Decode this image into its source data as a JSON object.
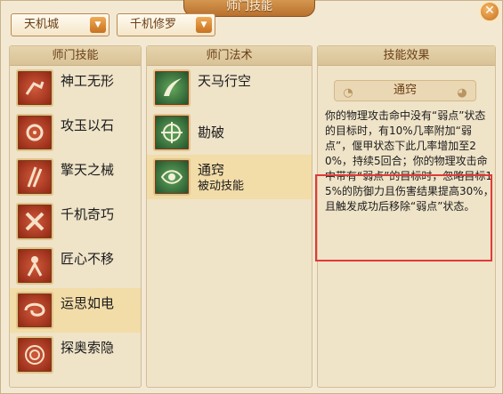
{
  "window": {
    "title": "师门技能",
    "close_symbol": "✕"
  },
  "filters": {
    "faction": {
      "selected": "天机城",
      "arrow_symbol": "▼"
    },
    "school": {
      "selected": "千机修罗",
      "arrow_symbol": "▼"
    }
  },
  "panels": {
    "skills": {
      "header": "师门技能",
      "items": [
        {
          "name": "神工无形",
          "icon": "hand-icon"
        },
        {
          "name": "攻玉以石",
          "icon": "gear-figure-icon"
        },
        {
          "name": "擎天之械",
          "icon": "pillar-icon"
        },
        {
          "name": "千机奇巧",
          "icon": "cross-tool-icon"
        },
        {
          "name": "匠心不移",
          "icon": "figure-icon"
        },
        {
          "name": "运思如电",
          "icon": "swirl-icon",
          "selected": true
        },
        {
          "name": "探奥索隐",
          "icon": "vortex-icon"
        }
      ]
    },
    "spells": {
      "header": "师门法术",
      "items": [
        {
          "name": "天马行空",
          "sub": "",
          "icon": "wing-icon"
        },
        {
          "name": "勘破",
          "sub": "",
          "icon": "target-icon"
        },
        {
          "name": "通窍",
          "sub": "被动技能",
          "icon": "eye-icon",
          "selected": true
        }
      ]
    },
    "effect": {
      "header": "技能效果",
      "skill_title": "通窍",
      "description": "你的物理攻击命中没有“弱点”状态的目标时，有10%几率附加“弱点”，偃甲状态下此几率增加至20%，持续5回合；你的物理攻击命中带有“弱点”的目标时，忽略目标15%的防御力且伤害结果提高30%，且触发成功后移除“弱点”状态。"
    }
  },
  "colors": {
    "accent": "#c77220",
    "highlight_border": "#e03a3a",
    "selected_row": "#f2dca8"
  }
}
